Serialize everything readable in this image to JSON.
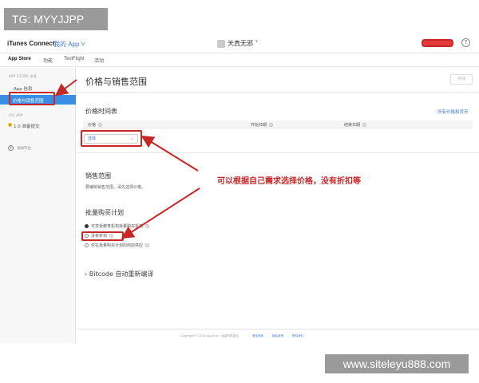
{
  "watermark_top": "TG: MYYJJPP",
  "watermark_bottom": "www.siteleyu888.com",
  "header": {
    "brand": "iTunes Connect",
    "my_app": "我的 App ˅",
    "app_name": "天真无邪 ˅",
    "help": "?"
  },
  "tabs": [
    "App Store",
    "功能",
    "TestFlight",
    "活动"
  ],
  "sidebar": {
    "section1": "APP STORE 信息",
    "app_info": "App 信息",
    "pricing": "价格与销售范围",
    "section2": "iOS APP",
    "version": "1.0 准备提交",
    "add_platform": "添加平台"
  },
  "main": {
    "title": "价格与销售范围",
    "save": "存储",
    "schedule_title": "价格时间表",
    "all_prices_link": "所有价格和货币",
    "col_price": "价格",
    "col_start": "开始日期",
    "col_end": "结束日期",
    "select_label": "选择",
    "availability_title": "销售范围",
    "availability_desc": "要编辑销售范围，请先选择价格。",
    "volume_title": "批量购买计划",
    "radio1": "可享受教育机构批量购买折扣",
    "radio2": "没有折扣",
    "radio3": "仅在批量购买计划的商店供应",
    "bitcode": "Bitcode 自动重新编译",
    "annotation": "可以根据自己需求选择价格，没有折扣等"
  },
  "footer": {
    "copyright": "Copyright © 2016 Apple Inc. 保留所有权利。",
    "terms": "服务条款",
    "privacy": "隐私政策",
    "contact": "联系我们"
  },
  "colors": {
    "accent": "#3a8ee6",
    "highlight": "#c62828",
    "link": "#3a7bd5"
  }
}
